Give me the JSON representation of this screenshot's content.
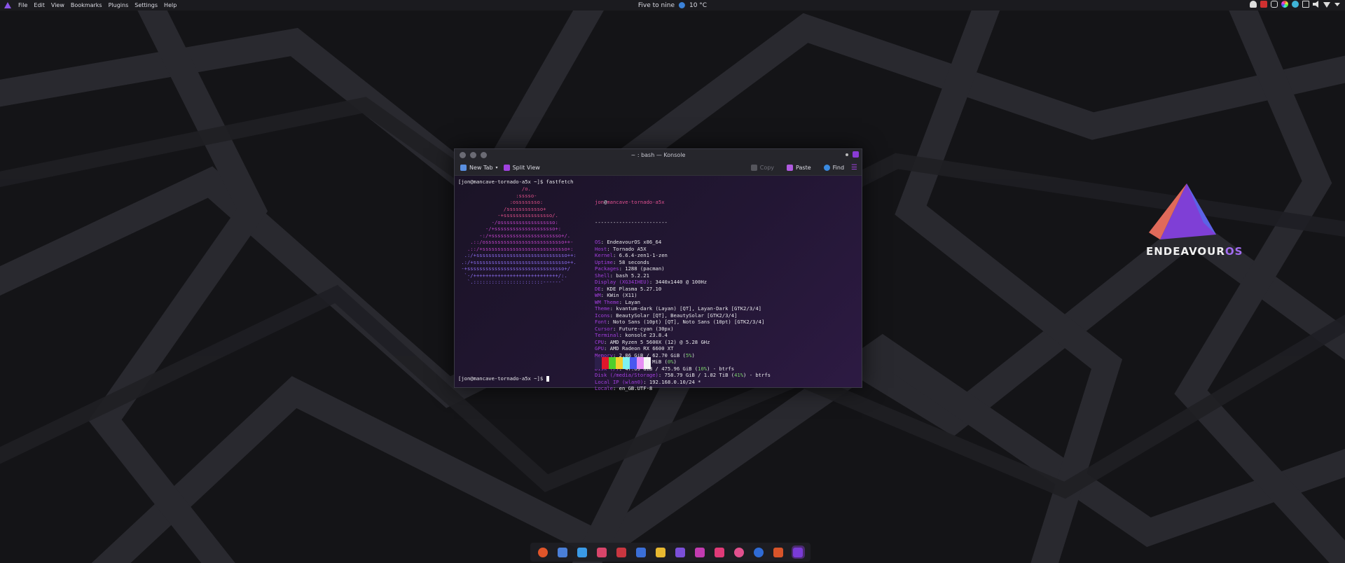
{
  "menubar": {
    "items": [
      "File",
      "Edit",
      "View",
      "Bookmarks",
      "Plugins",
      "Settings",
      "Help"
    ]
  },
  "panel": {
    "clock": "Five to nine",
    "weather": "10 °C",
    "tray_icons": [
      "bell-icon",
      "red-app-icon",
      "shield-icon",
      "palette-icon",
      "cloud-icon",
      "clipboard-icon",
      "volume-icon",
      "wifi-icon",
      "chevron-down-icon"
    ]
  },
  "konsole": {
    "title": "~ : bash — Konsole",
    "toolbar": {
      "new_tab": "New Tab",
      "split_view": "Split View",
      "copy": "Copy",
      "paste": "Paste",
      "find": "Find"
    },
    "prompt": "[jon@mancave-tornado-a5x ~]$ ",
    "command": "fastfetch",
    "art": [
      "                     /o.",
      "                   :sssso-",
      "                 :ossssssso:",
      "               /ssssssssssso+",
      "             -+ssssssssssssssso/.",
      "           -/ossssssssssssssssso:",
      "         -/+ssssssssssssssssssso+:",
      "       -:/+sssssssssssssssssssssso+/.",
      "    .::/ossssssssssssssssssssssssso++-",
      "   .::/+ssssssssssssssssssssssssssso+:",
      "  .:/+ssssssssssssssssssssssssssssso++:",
      " .:/+sssssssssssssssssssssssssssssso++.",
      " -+ssssssssssssssssssssssssssssssso+/",
      "  `-/++++++++++++++++++++++++++++/:.",
      "   `.:::::::::::::::::::::::------`"
    ],
    "info": {
      "user": "jon",
      "host": "mancave-tornado-a5x",
      "separator": "------------------------",
      "rows": [
        {
          "key": "OS",
          "value": "EndeavourOS x86_64"
        },
        {
          "key": "Host",
          "value": "Tornado A5X"
        },
        {
          "key": "Kernel",
          "value": "6.6.4-zen1-1-zen"
        },
        {
          "key": "Uptime",
          "value": "58 seconds"
        },
        {
          "key": "Packages",
          "value": "1288 (pacman)"
        },
        {
          "key": "Shell",
          "value": "bash 5.2.21"
        },
        {
          "key": "Display (XG34IHEU)",
          "value": "3440x1440 @ 100Hz"
        },
        {
          "key": "DE",
          "value": "KDE Plasma 5.27.10"
        },
        {
          "key": "WM",
          "value": "KWin (X11)"
        },
        {
          "key": "WM Theme",
          "value": "Layan"
        },
        {
          "key": "Theme",
          "value": "kvantum-dark (Layan) [QT], Layan-Dark [GTK2/3/4]"
        },
        {
          "key": "Icons",
          "value": "BeautySolar [QT], BeautySolar [GTK2/3/4]"
        },
        {
          "key": "Font",
          "value": "Noto Sans (10pt) [QT], Noto Sans (10pt) [GTK2/3/4]"
        },
        {
          "key": "Cursor",
          "value": "Future-cyan (30px)"
        },
        {
          "key": "Terminal",
          "value": "konsole 23.8.4"
        },
        {
          "key": "CPU",
          "value": "AMD Ryzen 5 5600X (12) @ 5.28 GHz"
        },
        {
          "key": "GPU",
          "value": "AMD Radeon RX 6600 XT"
        },
        {
          "key": "Memory",
          "value": "2.86 GiB / 62.70 GiB",
          "pct": "5%"
        },
        {
          "key": "Swap",
          "value": "0 B / 512.00 MiB",
          "pct": "0%"
        },
        {
          "key": "Disk (/)",
          "value": "47.69 GiB / 475.96 GiB",
          "pct": "10%",
          "suffix": " - btrfs"
        },
        {
          "key": "Disk (/media/Storage)",
          "value": "758.79 GiB / 1.82 TiB",
          "pct": "41%",
          "suffix": " - btrfs"
        },
        {
          "key": "Local IP (wlan0)",
          "value": "192.168.0.10/24 *"
        },
        {
          "key": "Locale",
          "value": "en_GB.UTF-8"
        }
      ],
      "palette": [
        "#2c1f4a",
        "#e0162b",
        "#4fcf2c",
        "#f2cf2e",
        "#7ef2f2",
        "#4a57f0",
        "#e68ef4",
        "#f4f4f4"
      ]
    }
  },
  "desktop_logo": {
    "text": "ENDEAVOUR",
    "text_os": "OS"
  },
  "dock": {
    "items": [
      {
        "name": "firefox-icon",
        "color": "#e0552a"
      },
      {
        "name": "mail-icon",
        "color": "#4a7fd8"
      },
      {
        "name": "telegram-icon",
        "color": "#3a9ae6"
      },
      {
        "name": "editor-icon",
        "color": "#d8456a"
      },
      {
        "name": "app-red-icon",
        "color": "#c83640"
      },
      {
        "name": "blue-app-icon",
        "color": "#3b6fd8"
      },
      {
        "name": "shield-yellow-icon",
        "color": "#e8b830"
      },
      {
        "name": "purple-app-icon",
        "color": "#7b4fd8"
      },
      {
        "name": "magenta-app-icon",
        "color": "#c23bb0"
      },
      {
        "name": "pink-app-icon",
        "color": "#e03a78"
      },
      {
        "name": "circle-pink-icon",
        "color": "#e2508e"
      },
      {
        "name": "blue-face-icon",
        "color": "#2f6bd6"
      },
      {
        "name": "orange-app-icon",
        "color": "#d8542a"
      },
      {
        "name": "konsole-icon",
        "color": "#7a3bd6"
      }
    ]
  }
}
